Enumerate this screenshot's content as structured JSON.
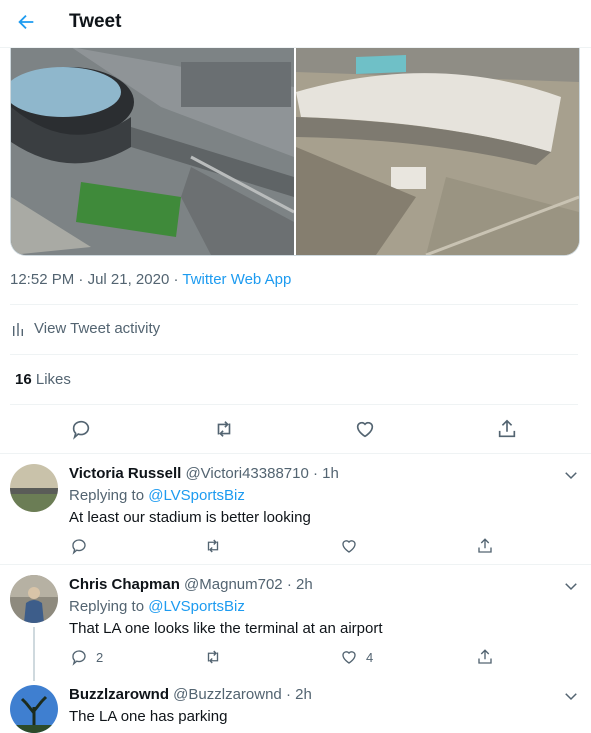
{
  "header": {
    "title": "Tweet"
  },
  "tweet": {
    "time": "12:52 PM",
    "sep": " · ",
    "date": "Jul 21, 2020",
    "source": "Twitter Web App",
    "activity_label": "View Tweet activity",
    "likes_count": "16",
    "likes_label": "Likes"
  },
  "replies": [
    {
      "name": "Victoria Russell",
      "handle": "@Victori43388710",
      "age": "1h",
      "replying_prefix": "Replying to",
      "replying_to": "@LVSportsBiz",
      "text": "At least our stadium is better looking",
      "reply_count": "",
      "like_count": ""
    },
    {
      "name": "Chris Chapman",
      "handle": "@Magnum702",
      "age": "2h",
      "replying_prefix": "Replying to",
      "replying_to": "@LVSportsBiz",
      "text": "That LA one looks like the terminal at an airport",
      "reply_count": "2",
      "like_count": "4"
    },
    {
      "name": "Buzzlzarownd",
      "handle": "@Buzzlzarownd",
      "age": "2h",
      "text": "The LA one has parking"
    }
  ],
  "colors": {
    "accent": "#1d9bf0",
    "muted": "#536471",
    "border": "#eff3f4"
  }
}
